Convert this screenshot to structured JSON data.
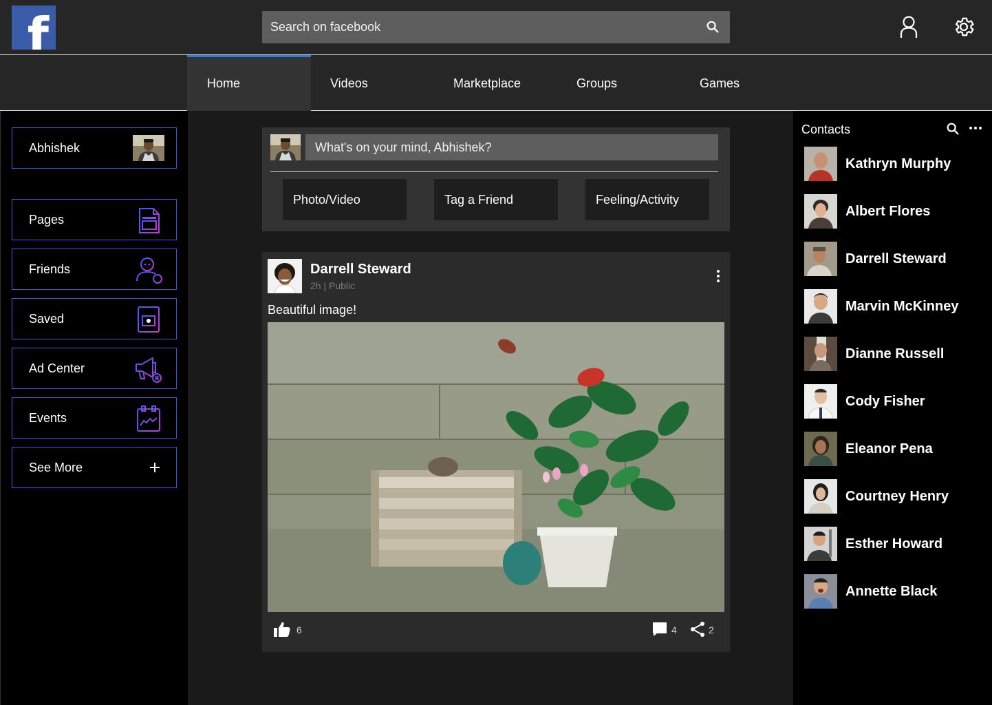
{
  "brand": {
    "logo_letter": "f",
    "logo_color": "#3b5ca8"
  },
  "header": {
    "search_placeholder": "Search on facebook"
  },
  "nav": {
    "tabs": [
      {
        "label": "Home",
        "active": true
      },
      {
        "label": "Videos",
        "active": false
      },
      {
        "label": "Marketplace",
        "active": false
      },
      {
        "label": "Groups",
        "active": false
      },
      {
        "label": "Games",
        "active": false
      }
    ],
    "active_color": "#2d7be3"
  },
  "sidebar": {
    "profile_name": "Abhishek",
    "items": [
      {
        "label": "Pages",
        "icon": "pages-icon"
      },
      {
        "label": "Friends",
        "icon": "friends-icon"
      },
      {
        "label": "Saved",
        "icon": "saved-icon"
      },
      {
        "label": "Ad Center",
        "icon": "ad-center-icon"
      },
      {
        "label": "Events",
        "icon": "events-icon"
      },
      {
        "label": "See More",
        "icon": "plus-icon"
      }
    ],
    "border_color": "#2f5fe0"
  },
  "composer": {
    "placeholder": "What's on your mind, Abhishek?",
    "actions": [
      "Photo/Video",
      "Tag a Friend",
      "Feeling/Activity"
    ]
  },
  "post": {
    "author": "Darrell Steward",
    "meta": "2h | Public",
    "text": "Beautiful image!",
    "likes": "6",
    "comments": "4",
    "shares": "2"
  },
  "contacts": {
    "title": "Contacts",
    "people": [
      "Kathryn Murphy",
      "Albert Flores",
      "Darrell Steward",
      "Marvin McKinney",
      "Dianne Russell",
      "Cody Fisher",
      "Eleanor Pena",
      "Courtney Henry",
      "Esther Howard",
      "Annette Black"
    ]
  }
}
